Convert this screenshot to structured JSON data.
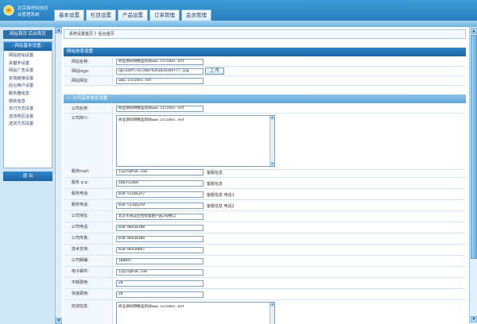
{
  "header": {
    "logo_line1": "北京商吧科技所",
    "logo_line2": "台管理系统",
    "tabs": [
      "基本设置",
      "栏目设置",
      "产品设置",
      "订单管理",
      "会员管理"
    ]
  },
  "sidebar": {
    "top_links": "网站首页  后台首页",
    "menu_title": "::网站基本设置::",
    "items": [
      "网站初始设置",
      "关键字设置",
      "网站广告设置",
      "友情链接设置",
      "后台用户设置",
      "服务器信息",
      "帮助信息",
      "支付方式设置",
      "送货地区设置",
      "送货方式设置"
    ],
    "logout": "退  出"
  },
  "breadcrumb": "系统设置首页 》后台首页",
  "section1": {
    "title": "网站信息设置",
    "fields": [
      {
        "label": "网站名称:",
        "value": "商业源码网精品测试www.zzcodes.net"
      },
      {
        "label": "网站logo:",
        "value": "uploadfile/20079281834169777.jpg"
      },
      {
        "label": "网站网址:",
        "value": "www.zzcodes.net"
      }
    ],
    "upload_label": "上  传"
  },
  "section2": {
    "title": ":::  公司基本信息设置",
    "company_name": {
      "label": "公司名称:",
      "value": "商业源码网精品测试www.zzcodes.net"
    },
    "company_intro": {
      "label": "公司简介:",
      "value": "商业源码网精品测试www.zzcodes.net"
    },
    "fields": [
      {
        "label": "服务mail:",
        "value": "z2pro@tom.com",
        "note": "客服信息"
      },
      {
        "label": "服务 q q:",
        "value": "108251468",
        "note": "客服信息"
      },
      {
        "label": "服务电话:",
        "value": "010-51266257",
        "note": "客服信息 电话1"
      },
      {
        "label": "服务电话:",
        "value": "010-51266259",
        "note": "客服信息 电话2"
      },
      {
        "label": "公司地址:",
        "value": "北京市海淀区拉拉城金户园2号楼1J",
        "note": ""
      },
      {
        "label": "公司电话:",
        "value": "010-88438300",
        "note": ""
      },
      {
        "label": "公司传真:",
        "value": "010-88438300",
        "note": ""
      },
      {
        "label": "技术支持:",
        "value": "010-88430097",
        "note": ""
      },
      {
        "label": "公司邮编:",
        "value": "100097",
        "note": ""
      },
      {
        "label": "电子邮件:",
        "value": "z2pro@tom.com",
        "note": ""
      },
      {
        "label": "平邮费用:",
        "value": "20",
        "note": ""
      },
      {
        "label": "快递费用:",
        "value": "20",
        "note": ""
      }
    ],
    "welcome": {
      "label": "欢迎信息:",
      "value": "商业源码网精品测试www.zzcodes.net"
    }
  }
}
